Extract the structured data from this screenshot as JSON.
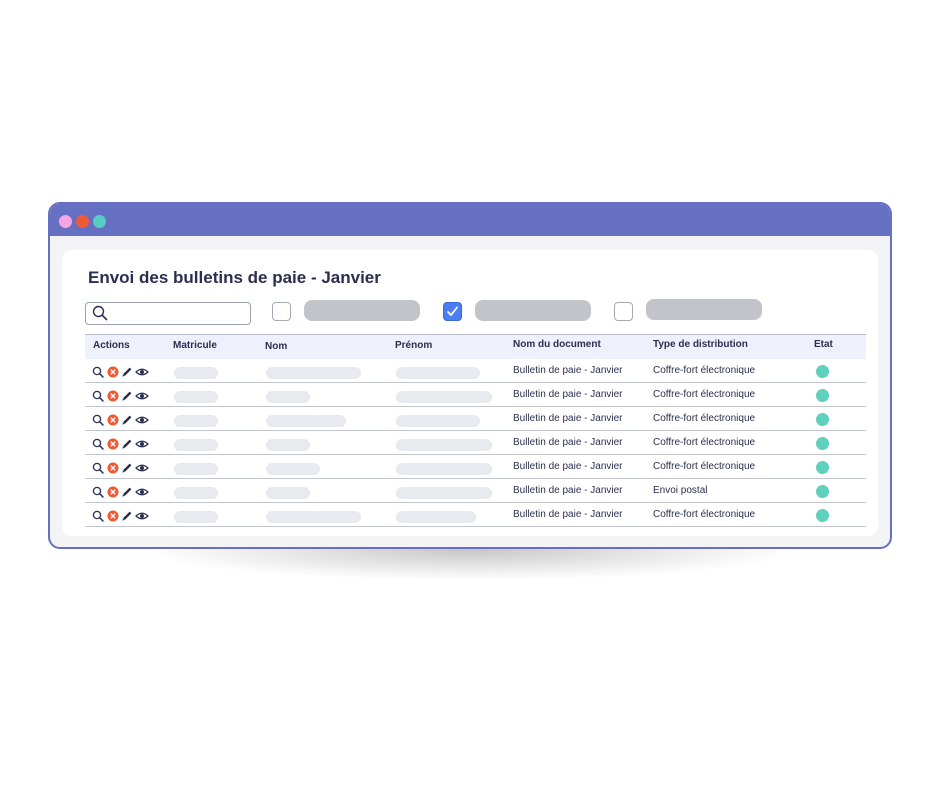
{
  "page": {
    "title": "Envoi des bulletins de paie - Janvier"
  },
  "filters": {
    "search_placeholder": "",
    "checkboxes": [
      {
        "checked": false
      },
      {
        "checked": true
      },
      {
        "checked": false
      }
    ]
  },
  "table": {
    "columns": [
      "Actions",
      "Matricule",
      "Nom",
      "Prénom",
      "Nom du document",
      "Type de distribution",
      "Etat"
    ],
    "rows": [
      {
        "document": "Bulletin de paie - Janvier",
        "distribution": "Coffre-fort électronique",
        "status_color": "#5fd0bb"
      },
      {
        "document": "Bulletin de paie - Janvier",
        "distribution": "Coffre-fort électronique",
        "status_color": "#5fd0bb"
      },
      {
        "document": "Bulletin de paie - Janvier",
        "distribution": "Coffre-fort électronique",
        "status_color": "#5fd0bb"
      },
      {
        "document": "Bulletin de paie - Janvier",
        "distribution": "Coffre-fort électronique",
        "status_color": "#5fd0bb"
      },
      {
        "document": "Bulletin de paie - Janvier",
        "distribution": "Coffre-fort électronique",
        "status_color": "#5fd0bb"
      },
      {
        "document": "Bulletin de paie - Janvier",
        "distribution": "Envoi postal",
        "status_color": "#5fd0bb"
      },
      {
        "document": "Bulletin de paie - Janvier",
        "distribution": "Coffre-fort électronique",
        "status_color": "#5fd0bb"
      }
    ],
    "action_icons": [
      "search-icon",
      "delete-icon",
      "edit-icon",
      "view-icon"
    ]
  },
  "colors": {
    "titlebar": "#6670c2",
    "accent": "#4c7df2",
    "status_ok": "#5fd0bb",
    "delete": "#f15a36"
  }
}
